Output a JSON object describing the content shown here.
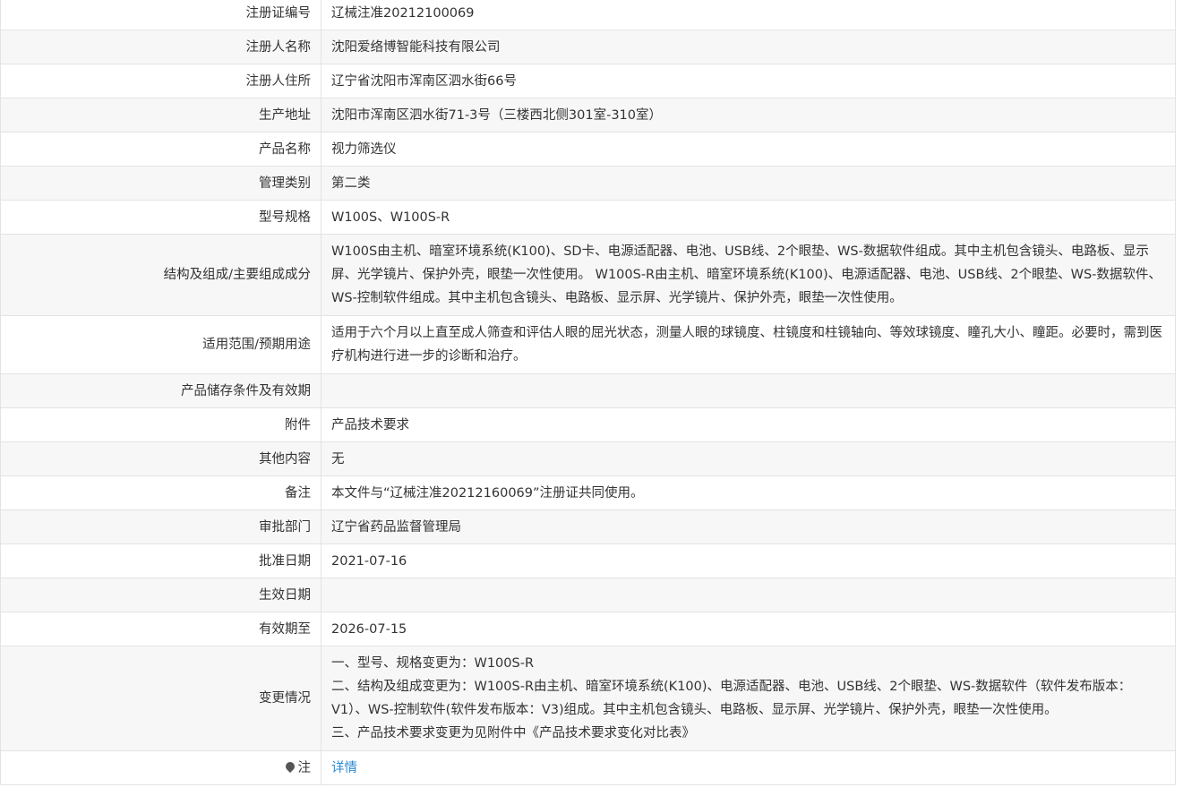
{
  "rows": [
    {
      "label": "注册证编号",
      "value": "辽械注准20212100069"
    },
    {
      "label": "注册人名称",
      "value": "沈阳爱络博智能科技有限公司"
    },
    {
      "label": "注册人住所",
      "value": "辽宁省沈阳市浑南区泗水街66号"
    },
    {
      "label": "生产地址",
      "value": "沈阳市浑南区泗水街71-3号（三楼西北侧301室-310室）"
    },
    {
      "label": "产品名称",
      "value": "视力筛选仪"
    },
    {
      "label": "管理类别",
      "value": "第二类"
    },
    {
      "label": "型号规格",
      "value": "W100S、W100S-R"
    },
    {
      "label": "结构及组成/主要组成成分",
      "value": "W100S由主机、暗室环境系统(K100)、SD卡、电源适配器、电池、USB线、2个眼垫、WS-数据软件组成。其中主机包含镜头、电路板、显示屏、光学镜片、保护外壳，眼垫一次性使用。 W100S-R由主机、暗室环境系统(K100)、电源适配器、电池、USB线、2个眼垫、WS-数据软件、WS-控制软件组成。其中主机包含镜头、电路板、显示屏、光学镜片、保护外壳，眼垫一次性使用。"
    },
    {
      "label": "适用范围/预期用途",
      "value": "适用于六个月以上直至成人筛查和评估人眼的屈光状态，测量人眼的球镜度、柱镜度和柱镜轴向、等效球镜度、瞳孔大小、瞳距。必要时，需到医疗机构进行进一步的诊断和治疗。"
    },
    {
      "label": "产品储存条件及有效期",
      "value": ""
    },
    {
      "label": "附件",
      "value": "产品技术要求"
    },
    {
      "label": "其他内容",
      "value": "无"
    },
    {
      "label": "备注",
      "value": "本文件与“辽械注准20212160069”注册证共同使用。"
    },
    {
      "label": "审批部门",
      "value": "辽宁省药品监督管理局"
    },
    {
      "label": "批准日期",
      "value": "2021-07-16"
    },
    {
      "label": "生效日期",
      "value": ""
    },
    {
      "label": "有效期至",
      "value": "2026-07-15"
    }
  ],
  "changes": {
    "label": "变更情况",
    "lines": [
      "一、型号、规格变更为：W100S-R",
      "二、结构及组成变更为：W100S-R由主机、暗室环境系统(K100)、电源适配器、电池、USB线、2个眼垫、WS-数据软件（软件发布版本：V1）、WS-控制软件(软件发布版本：V3)组成。其中主机包含镜头、电路板、显示屏、光学镜片、保护外壳，眼垫一次性使用。",
      "三、产品技术要求变更为见附件中《产品技术要求变化对比表》"
    ]
  },
  "note": {
    "icon": "pin-icon",
    "label": "注",
    "link": "详情"
  }
}
